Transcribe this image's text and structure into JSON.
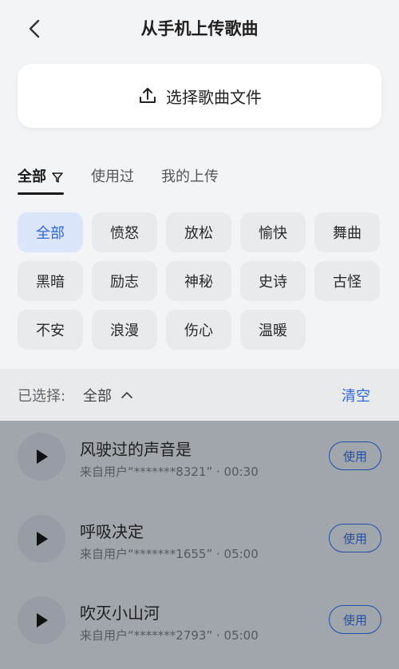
{
  "header": {
    "title": "从手机上传歌曲"
  },
  "upload": {
    "label": "选择歌曲文件"
  },
  "tabs": [
    {
      "label": "全部",
      "active": true
    },
    {
      "label": "使用过",
      "active": false
    },
    {
      "label": "我的上传",
      "active": false
    }
  ],
  "categories": [
    {
      "label": "全部",
      "selected": true
    },
    {
      "label": "愤怒"
    },
    {
      "label": "放松"
    },
    {
      "label": "愉快"
    },
    {
      "label": "舞曲"
    },
    {
      "label": "黑暗"
    },
    {
      "label": "励志"
    },
    {
      "label": "神秘"
    },
    {
      "label": "史诗"
    },
    {
      "label": "古怪"
    },
    {
      "label": "不安"
    },
    {
      "label": "浪漫"
    },
    {
      "label": "伤心"
    },
    {
      "label": "温暖"
    }
  ],
  "selection": {
    "label": "已选择:",
    "value": "全部",
    "clear_label": "清空"
  },
  "songs": [
    {
      "title": "风驶过的声音是",
      "meta": "来自用户“*******8321” · 00:30",
      "use_label": "使用"
    },
    {
      "title": "呼吸决定",
      "meta": "来自用户“*******1655” · 05:00",
      "use_label": "使用"
    },
    {
      "title": "吹灭小山河",
      "meta": "来自用户“*******2793” · 05:00",
      "use_label": "使用"
    }
  ],
  "colors": {
    "accent": "#2e66d4",
    "selected_chip_bg": "#dbe6fb",
    "overlay": "#a1a6ad"
  }
}
